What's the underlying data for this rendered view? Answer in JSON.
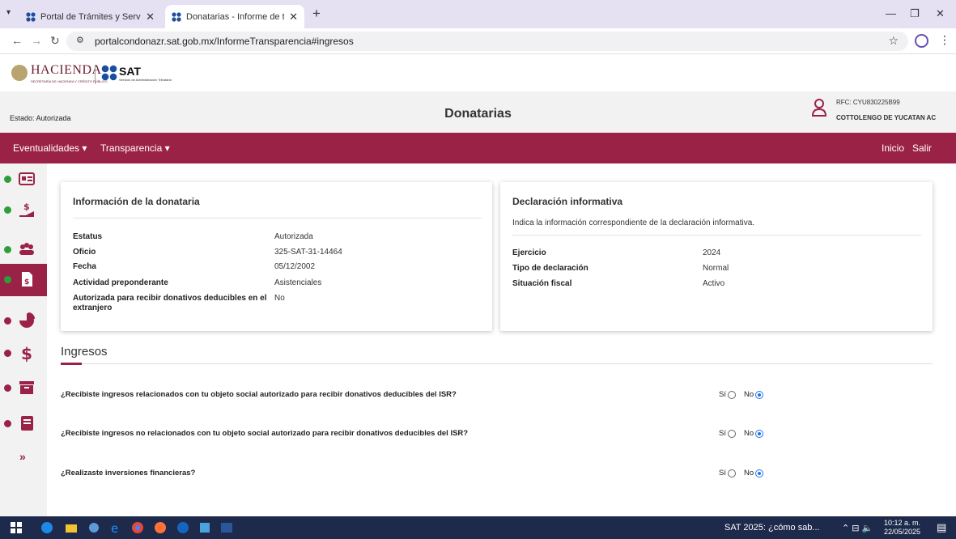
{
  "browser": {
    "tabs": [
      {
        "title": "Portal de Trámites y Servicios de",
        "active": false
      },
      {
        "title": "Donatarias - Informe de transpa",
        "active": true
      }
    ],
    "url": "portalcondonazr.sat.gob.mx/InformeTransparencia#ingresos"
  },
  "header": {
    "hacienda": "HACIENDA",
    "hacienda_sub": "SECRETARÍA DE HACIENDA Y CRÉDITO PÚBLICO",
    "sat": "SAT",
    "sat_sub": "Servicio de Administración Tributaria"
  },
  "titlebar": {
    "estado": "Estado: Autorizada",
    "title": "Donatarias",
    "rfc": "RFC: CYU830225B99",
    "org": "COTTOLENGO DE YUCATAN AC"
  },
  "nav": {
    "left": [
      "Eventualidades ▾",
      "Transparencia ▾"
    ],
    "right": [
      "Inicio",
      "Salir"
    ]
  },
  "rail": {
    "items": [
      {
        "icon": "id-card-icon",
        "status": "green",
        "active": false
      },
      {
        "icon": "hand-money-icon",
        "status": "green",
        "active": false
      },
      {
        "icon": "group-icon",
        "status": "green",
        "active": false
      },
      {
        "icon": "document-money-icon",
        "status": "green",
        "active": true
      },
      {
        "icon": "pie-chart-icon",
        "status": "red",
        "active": false
      },
      {
        "icon": "dollar-icon",
        "status": "red",
        "active": false
      },
      {
        "icon": "archive-icon",
        "status": "red",
        "active": false
      },
      {
        "icon": "book-icon",
        "status": "red",
        "active": false
      }
    ],
    "more": "»"
  },
  "info_card": {
    "title": "Información de la donataria",
    "rows": [
      {
        "label": "Estatus",
        "value": "Autorizada"
      },
      {
        "label": "Oficio",
        "value": "325-SAT-31-14464"
      },
      {
        "label": "Fecha",
        "value": "05/12/2002"
      },
      {
        "label": "Actividad preponderante",
        "value": "Asistenciales"
      },
      {
        "label": "Autorizada para recibir donativos deducibles en el extranjero",
        "value": "No"
      }
    ]
  },
  "decl_card": {
    "title": "Declaración informativa",
    "subtitle": "Indica la información correspondiente de la declaración informativa.",
    "rows": [
      {
        "label": "Ejercicio",
        "value": "2024"
      },
      {
        "label": "Tipo de declaración",
        "value": "Normal"
      },
      {
        "label": "Situación fiscal",
        "value": "Activo"
      }
    ]
  },
  "ingresos": {
    "title": "Ingresos",
    "questions": [
      {
        "text": "¿Recibiste ingresos relacionados con tu objeto social autorizado para recibir donativos deducibles del ISR?",
        "si": "Sí",
        "no": "No",
        "selected": "No"
      },
      {
        "text": "¿Recibiste ingresos no relacionados con tu objeto social autorizado para recibir donativos deducibles del ISR?",
        "si": "Sí",
        "no": "No",
        "selected": "No"
      },
      {
        "text": "¿Realizaste inversiones financieras?",
        "si": "Sí",
        "no": "No",
        "selected": "No"
      }
    ]
  },
  "taskbar": {
    "news": "SAT 2025: ¿cómo sab...",
    "time": "10:12 a. m.",
    "date": "22/05/2025"
  },
  "colors": {
    "brand": "#9b2247",
    "status_green": "#2e9e3a",
    "status_red": "#9b2247"
  }
}
